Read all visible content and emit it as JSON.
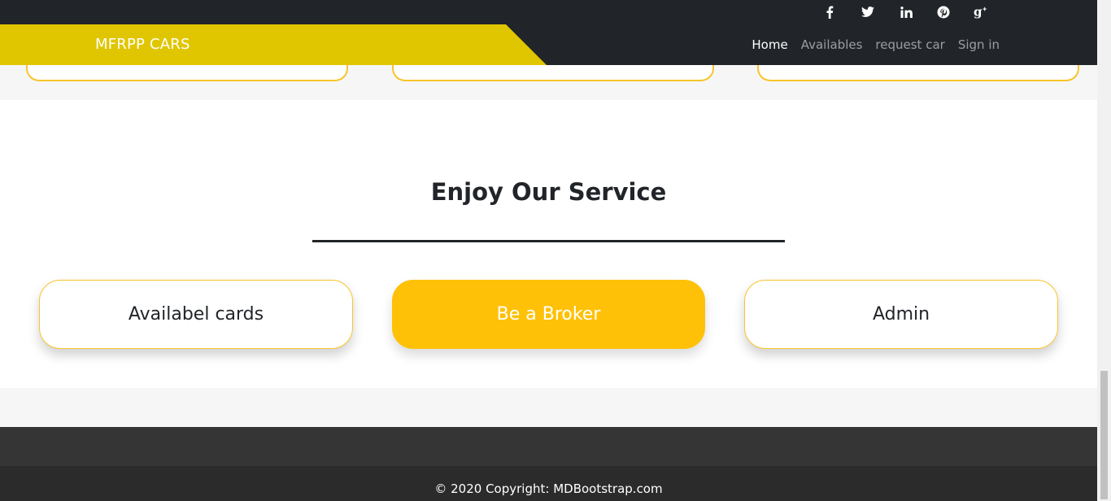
{
  "navbar": {
    "brand": "MFRPP CARS",
    "links": [
      {
        "label": "Home",
        "active": true
      },
      {
        "label": "Availables",
        "active": false
      },
      {
        "label": "request car",
        "active": false
      },
      {
        "label": "Sign in",
        "active": false
      }
    ],
    "brand_color": "#e0c600",
    "background": "#212529"
  },
  "social": [
    {
      "icon": "facebook-icon"
    },
    {
      "icon": "twitter-icon"
    },
    {
      "icon": "linkedin-icon"
    },
    {
      "icon": "pinterest-icon"
    },
    {
      "icon": "google-plus-icon"
    }
  ],
  "service": {
    "title": "Enjoy Our Service",
    "buttons": [
      {
        "label": "Availabel cards"
      },
      {
        "label": "Be a Broker"
      },
      {
        "label": "Admin"
      }
    ],
    "accent": "#ffc107"
  },
  "footer": {
    "copyright": "© 2020 Copyright: MDBootstrap.com"
  }
}
